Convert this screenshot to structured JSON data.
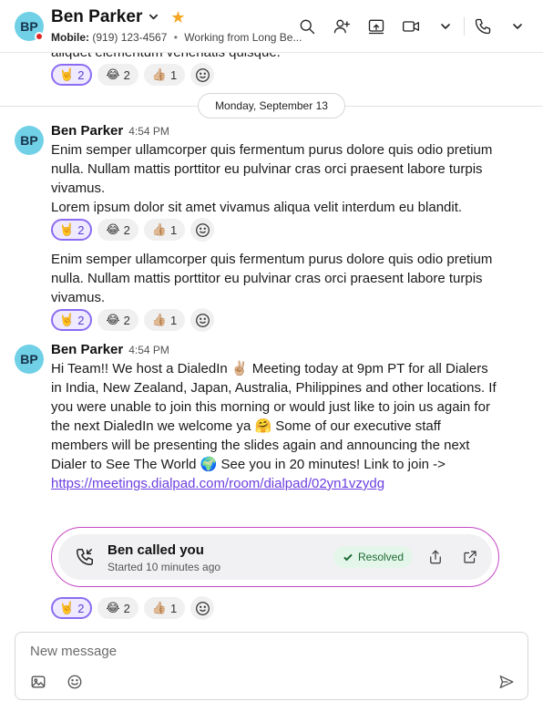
{
  "header": {
    "avatar_initials": "BP",
    "name": "Ben Parker",
    "phone_label": "Mobile:",
    "phone": "(919) 123-4567",
    "separator": "•",
    "status": "Working from Long Be..."
  },
  "feed": {
    "partial_text": "aliquet elementum venenatis quisque.",
    "date_divider": "Monday, September 13",
    "messages": [
      {
        "avatar": "BP",
        "name": "Ben Parker",
        "time": "4:54 PM",
        "text_1": "Enim semper ullamcorper quis fermentum purus dolore quis odio pretium nulla. Nullam mattis porttitor eu pulvinar cras orci praesent labore turpis vivamus.",
        "text_2": "Lorem ipsum dolor sit amet vivamus aliqua velit interdum eu blandit.",
        "text_3": "Enim semper ullamcorper quis fermentum purus dolore quis odio pretium nulla. Nullam mattis porttitor eu pulvinar cras orci praesent labore turpis vivamus."
      },
      {
        "avatar": "BP",
        "name": "Ben Parker",
        "time": "4:54 PM",
        "text": "Hi Team!!  We host a DialedIn ✌🏼 Meeting today at 9pm PT for all Dialers in India, New Zealand, Japan, Australia, Philippines and other locations.  If you were unable to join this morning or would just like to join us again for the next DialedIn we welcome ya 🤗 Some of our executive staff members will be presenting the slides again and announcing the next Dialer to See The World 🌍 See you in 20 minutes! Link to join -> ",
        "link": "https://meetings.dialpad.com/room/dialpad/02yn1vzydg"
      }
    ],
    "reactions": [
      {
        "emoji": "🤘",
        "count": "2",
        "active": true
      },
      {
        "emoji": "😂",
        "count": "2",
        "active": false
      },
      {
        "emoji": "👍🏼",
        "count": "1",
        "active": false
      }
    ]
  },
  "call_card": {
    "title": "Ben called you",
    "subtitle": "Started 10 minutes ago",
    "status": "Resolved"
  },
  "composer": {
    "placeholder": "New message"
  },
  "colors": {
    "avatar_bg": "#6fd0e6",
    "accent_purple": "#8b6cf2",
    "card_border": "#c548c5",
    "resolved_bg": "#e4f6e9",
    "star": "#f5a623",
    "presence_dot": "#e02424"
  }
}
